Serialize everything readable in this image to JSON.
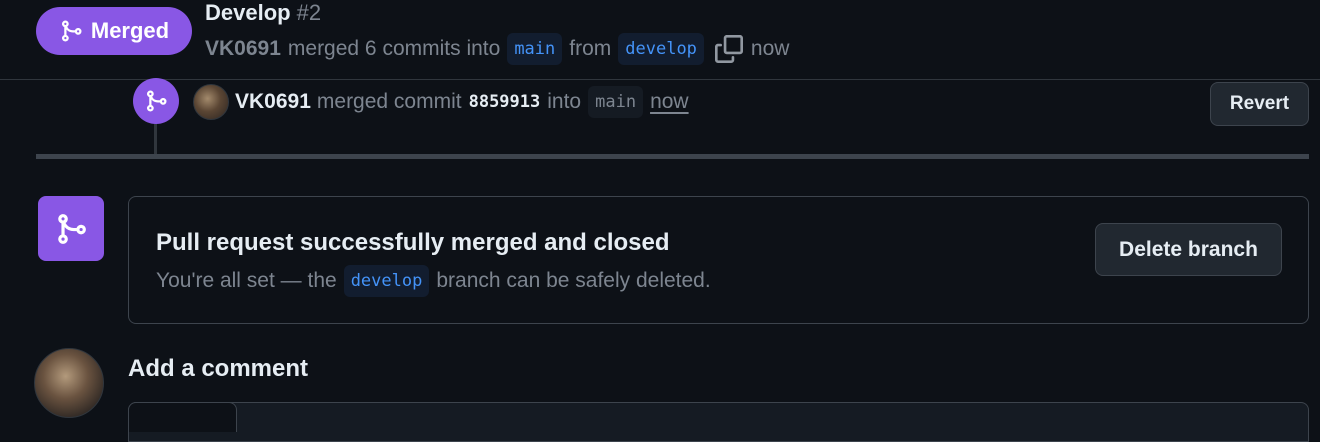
{
  "header": {
    "state_label": "Merged",
    "title": "Develop",
    "number": "#2",
    "author": "VK0691",
    "action_text": "merged 6 commits into",
    "base_branch": "main",
    "from_text": "from",
    "head_branch": "develop",
    "time": "now"
  },
  "event": {
    "author": "VK0691",
    "action_text": "merged commit",
    "sha": "8859913",
    "into_text": "into",
    "branch": "main",
    "time": "now",
    "revert_label": "Revert"
  },
  "merge_box": {
    "title": "Pull request successfully merged and closed",
    "desc_before": "You're all set — the",
    "branch": "develop",
    "desc_after": "branch can be safely deleted.",
    "delete_label": "Delete branch"
  },
  "comment": {
    "heading": "Add a comment"
  },
  "colors": {
    "merged_purple": "#8957e5",
    "background": "#0d1117",
    "border": "#3d444d",
    "branch_blue": "#4493f8",
    "muted_text": "#7d8590"
  },
  "icons": {
    "merge": "git-merge-icon",
    "copy": "copy-icon"
  }
}
